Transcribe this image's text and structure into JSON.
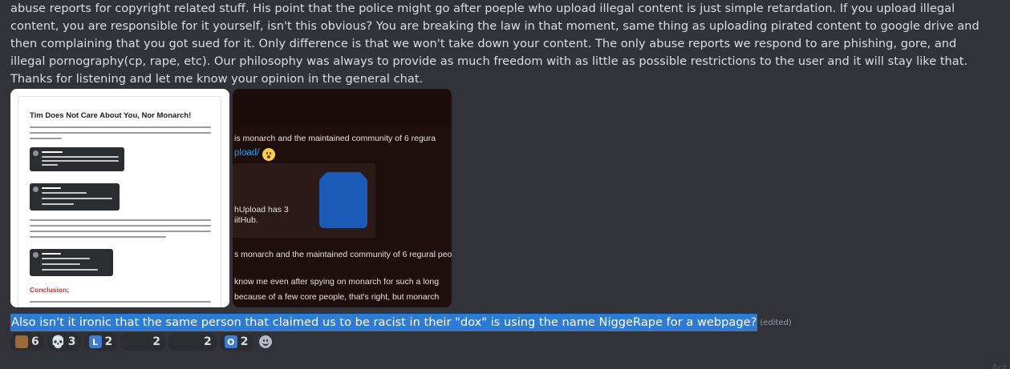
{
  "message": {
    "body": "abuse reports for copyright related stuff. His point that the police might go after poeple who upload illegal content is just simple retardation. If you upload illegal content, you are responsible for it yourself, isn't this obvious? You are breaking the law in that moment, same thing as uploading pirated content to google drive and then complaining that you got sued for it. Only difference is that we won't take down your content. The only abuse reports we respond to are phishing, gore, and illegal pornography(cp, rape, etc). Our philosophy was always to provide as much freedom  with as little as possible restrictions to the user and it will stay like that. Thanks for listening and let me know your opinion in the general chat.",
    "highlighted_line": "Also isn't it ironic that the same person that claimed us to be racist in their \"dox\" is using the name NiggeRape for a webpage?",
    "edited_label": "(edited)"
  },
  "attachments": {
    "doc": {
      "title": "Tim Does Not Care About You, Nor Monarch!",
      "conclusion": "Conclusion:"
    },
    "dark": {
      "line1": "is monarch and the maintained community of 6 regura",
      "link": "pload/",
      "card_line1": "hUpload has 3",
      "card_line2": "iitHub.",
      "line2": "s monarch and the maintained community of 6 regural people",
      "line3": "know me even after spying on monarch for such a long",
      "line4": "because of a few core people, that's right, but monarch"
    }
  },
  "reactions": [
    {
      "icon": "box-emoji-icon",
      "glyph": "",
      "count": "6"
    },
    {
      "icon": "skull-emoji-icon",
      "glyph": "💀",
      "count": "3"
    },
    {
      "icon": "letter-l-emoji-icon",
      "glyph": "L",
      "count": "2"
    },
    {
      "icon": "custom-emoji-icon",
      "glyph": "",
      "count": "2"
    },
    {
      "icon": "custom-emoji-icon",
      "glyph": "",
      "count": "2"
    },
    {
      "icon": "letter-o-emoji-icon",
      "glyph": "O",
      "count": "2"
    }
  ],
  "corner_hint": "Act",
  "colors": {
    "background": "#313338",
    "highlight": "#2e7bd6",
    "link": "#00a8fc"
  }
}
